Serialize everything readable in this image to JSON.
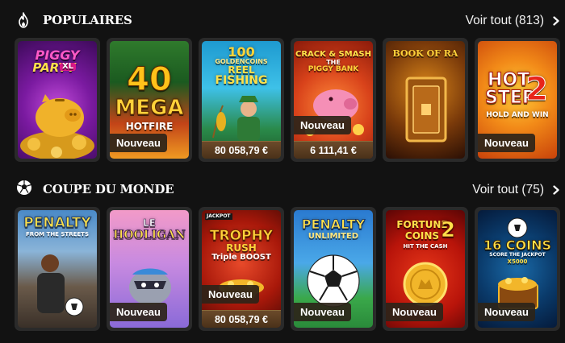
{
  "sections": [
    {
      "title": "POPULAIRES",
      "icon": "flame-icon",
      "see_all": "Voir tout (813)",
      "games": [
        {
          "title_lines": [
            "PIGGY",
            "PARTY",
            "XL"
          ],
          "badge": "",
          "jackpot": ""
        },
        {
          "title_lines": [
            "40",
            "MEGA",
            "HOTFIRE"
          ],
          "badge": "Nouveau",
          "jackpot": ""
        },
        {
          "title_lines": [
            "100",
            "GOLDENCOINS",
            "REEL",
            "FISHING"
          ],
          "badge": "",
          "jackpot": "80 058,79 €"
        },
        {
          "title_lines": [
            "CRACK & SMASH",
            "THE",
            "PIGGY BANK"
          ],
          "badge": "Nouveau",
          "jackpot": "6 111,41 €"
        },
        {
          "title_lines": [
            "BOOK OF RA"
          ],
          "badge": "",
          "jackpot": ""
        },
        {
          "title_lines": [
            "HOT",
            "STEP",
            "2",
            "HOLD AND WIN"
          ],
          "badge": "Nouveau",
          "jackpot": ""
        }
      ]
    },
    {
      "title": "COUPE DU MONDE",
      "icon": "soccer-ball-icon",
      "see_all": "Voir tout (75)",
      "games": [
        {
          "title_lines": [
            "PENALTY",
            "FROM THE STREETS"
          ],
          "badge": "",
          "jackpot": ""
        },
        {
          "title_lines": [
            "LE",
            "HOOLIGAN"
          ],
          "badge": "Nouveau",
          "jackpot": ""
        },
        {
          "title_lines": [
            "JACKPOT",
            "TROPHY",
            "RUSH",
            "Triple BOOST"
          ],
          "badge": "Nouveau",
          "jackpot": "80 058,79 €"
        },
        {
          "title_lines": [
            "PENALTY",
            "UNLIMITED"
          ],
          "badge": "Nouveau",
          "jackpot": ""
        },
        {
          "title_lines": [
            "FORTUNE",
            "COINS",
            "2",
            "HIT THE CASH"
          ],
          "badge": "Nouveau",
          "jackpot": ""
        },
        {
          "title_lines": [
            "16 COINS",
            "SCORE THE JACKPOT",
            "X5000"
          ],
          "badge": "Nouveau",
          "jackpot": ""
        }
      ]
    }
  ],
  "colors": {
    "background": "#121212",
    "card": "#2a2a2a",
    "badge": "#2d2419",
    "jackpot_bar": "#5a3c20"
  }
}
